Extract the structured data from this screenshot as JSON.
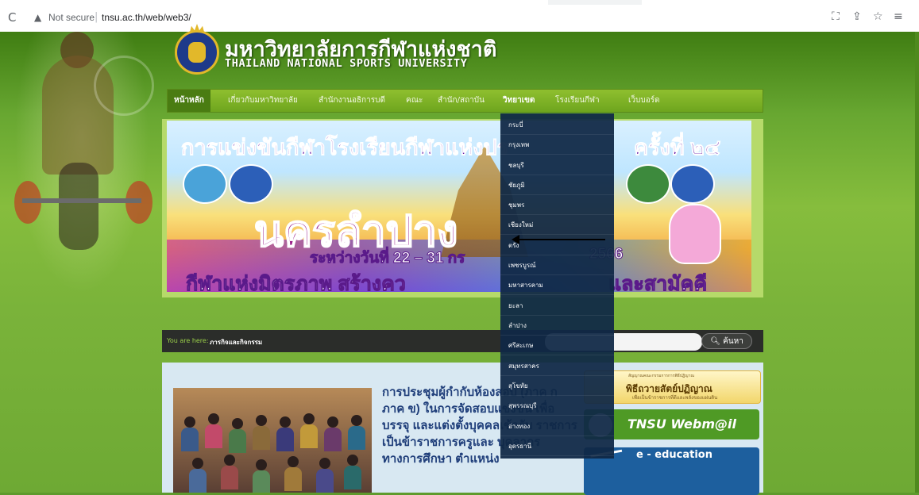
{
  "browser": {
    "reload_icon": "reload-icon",
    "security_label": "Not secure",
    "url": "tnsu.ac.th/web/web3/",
    "icons": [
      "translate-icon",
      "share-icon",
      "bookmark-star-icon",
      "reading-list-icon"
    ]
  },
  "header": {
    "thai_title": "มหาวิทยาลัยการกีฬาแห่งชาติ",
    "english_title": "THAILAND NATIONAL SPORTS UNIVERSITY"
  },
  "nav": {
    "items": [
      {
        "label": "หน้าหลัก"
      },
      {
        "label": "เกี่ยวกับมหาวิทยาลัย"
      },
      {
        "label": "สำนักงานอธิการบดี"
      },
      {
        "label": "คณะ"
      },
      {
        "label": "สำนัก/สถาบัน"
      },
      {
        "label": "วิทยาเขต"
      },
      {
        "label": "โรงเรียนกีฬา"
      },
      {
        "label": "เว็บบอร์ด"
      }
    ]
  },
  "banner": {
    "headline": "การแข่งขันกีฬาโรงเรียนกีฬาแห่งปร",
    "headline_right": "ครั้งที่ ๒๔",
    "big_text": "นครลำปาง",
    "dates": "ระหว่างวันที่ 22 – 31 กร",
    "dates_right": "2566",
    "slogan": "กีฬาแห่งมิตรภาพ สร้างคว",
    "slogan_right": "และสามัคคี"
  },
  "campus_dropdown": {
    "options": [
      "กระบี่",
      "กรุงเทพ",
      "ชลบุรี",
      "ชัยภูมิ",
      "ชุมพร",
      "เชียงใหม่",
      "ตรัง",
      "เพชรบูรณ์",
      "มหาสารคาม",
      "ยะลา",
      "ลำปาง",
      "ศรีสะเกษ",
      "สมุทรสาคร",
      "สุโขทัย",
      "สุพรรณบุรี",
      "อ่างทอง",
      "อุดรธานี"
    ]
  },
  "breadcrumb": {
    "prefix": "You are here:",
    "current": "ภารกิจและกิจกรรม"
  },
  "search": {
    "placeholder": "",
    "button_label": "ค้นหา"
  },
  "news": {
    "title": "การประชุมผู้กำกับห้องสอบ (ภาค ก ภาค ข) ในการจัดสอบแข่งขัน เพื่อบรรจุ และแต่งตั้งบุคคลเข้ารับ ราชการเป็นข้าราชการครูและ บุคลากรทางการศึกษา ตำแหน่ง"
  },
  "sidebar_ads": {
    "ad1_top": "สัญญาณคณะกรรมการการพิธีปฏิญาณ",
    "ad1_title": "พิธีถวายสัตย์ปฏิญาณ",
    "ad1_sub": "เพื่อเป็นข้าราชการที่ดีและพลังของแผ่นดิน",
    "ad2_title": "TNSU Webm@il",
    "ad3_title": "e - education"
  }
}
